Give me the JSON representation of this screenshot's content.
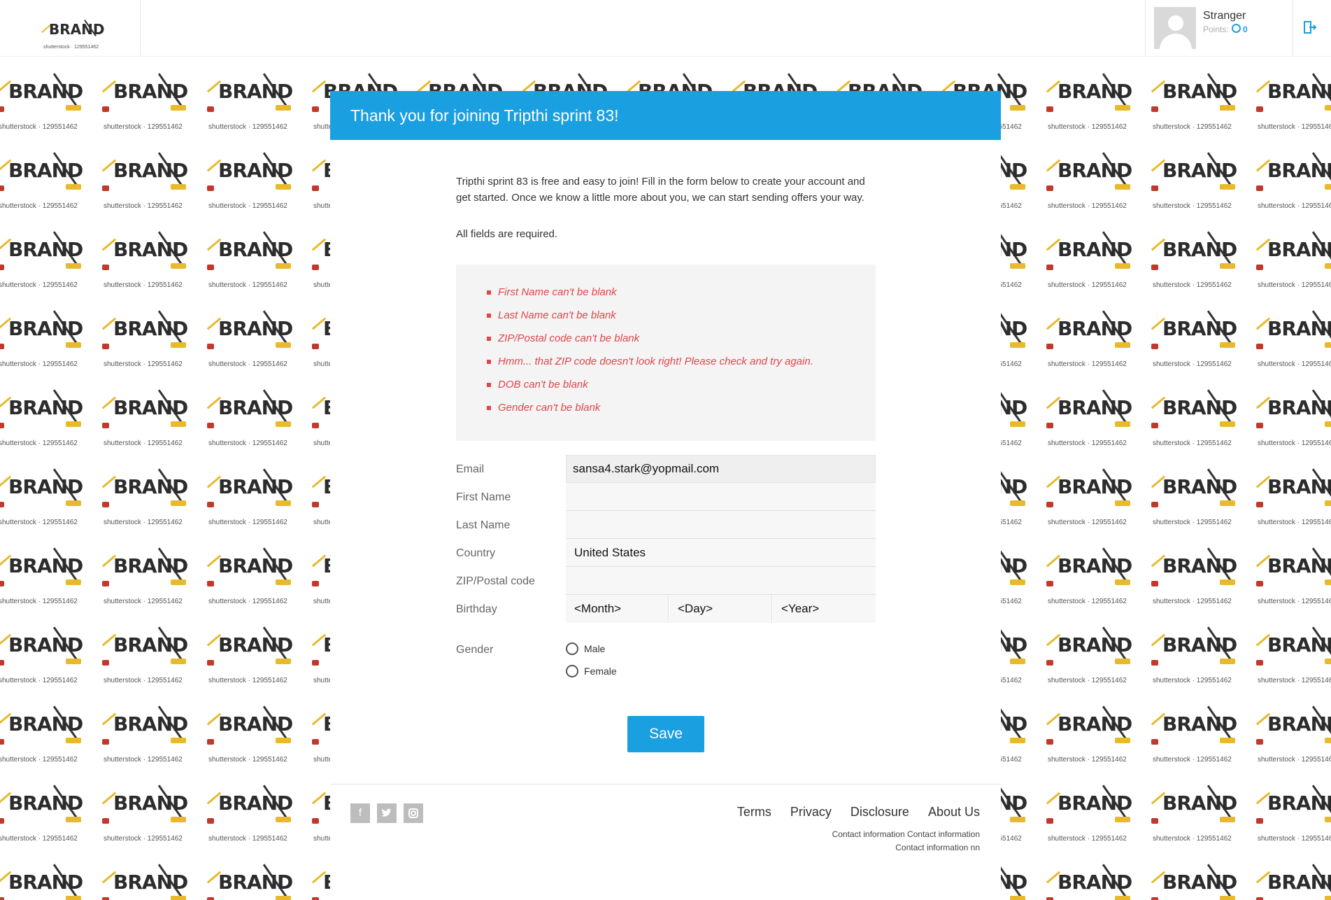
{
  "header": {
    "logo_text": "BRAND",
    "logo_watermark": "shutterstock · 129551462",
    "user_name": "Stranger",
    "points_label": "Points:",
    "points_value": "0"
  },
  "background": {
    "watermark": "shutterstock · 129551462",
    "brand": "BRAND"
  },
  "banner": {
    "title": "Thank you for joining Tripthi sprint 83!"
  },
  "intro": {
    "text": "Tripthi sprint 83 is free and easy to join! Fill in the form below to create your account and get started. Once we know a little more about you, we can start sending offers your way.",
    "required": "All fields are required."
  },
  "errors": [
    "First Name can't be blank",
    "Last Name can't be blank",
    "ZIP/Postal code can't be blank",
    "Hmm... that ZIP code doesn't look right! Please check and try again.",
    "DOB can't be blank",
    "Gender can't be blank"
  ],
  "form": {
    "email_label": "Email",
    "email_value": "sansa4.stark@yopmail.com",
    "first_name_label": "First Name",
    "first_name_value": "",
    "last_name_label": "Last Name",
    "last_name_value": "",
    "country_label": "Country",
    "country_value": "United States",
    "zip_label": "ZIP/Postal code",
    "zip_value": "",
    "birthday_label": "Birthday",
    "month_value": "<Month>",
    "day_value": "<Day>",
    "year_value": "<Year>",
    "gender_label": "Gender",
    "gender_options": [
      "Male",
      "Female"
    ],
    "save_label": "Save"
  },
  "footer": {
    "links": [
      "Terms",
      "Privacy",
      "Disclosure",
      "About Us"
    ],
    "contact_line1": "Contact information Contact information",
    "contact_line2": "Contact information nn",
    "social_icons": [
      "facebook-icon",
      "twitter-icon",
      "instagram-icon"
    ]
  },
  "colors": {
    "accent": "#1a9fe0",
    "error": "#e2444b"
  }
}
